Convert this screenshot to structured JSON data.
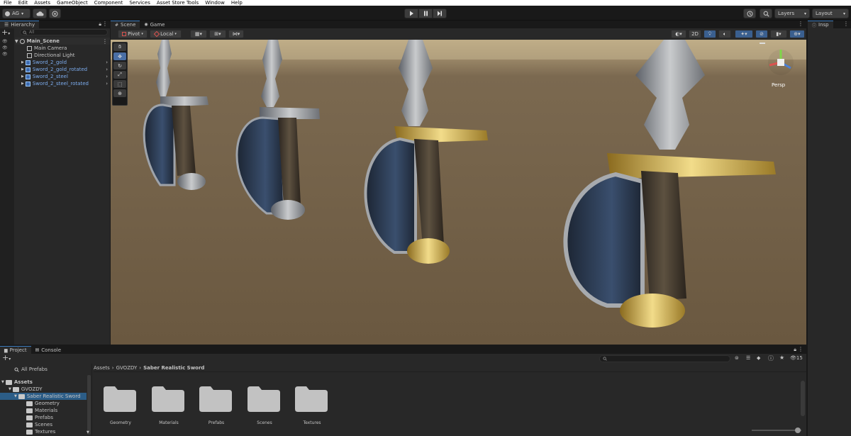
{
  "menu": [
    "File",
    "Edit",
    "Assets",
    "GameObject",
    "Component",
    "Services",
    "Asset Store Tools",
    "Window",
    "Help"
  ],
  "toolbar": {
    "account": "AG",
    "layers": "Layers",
    "layout": "Layout"
  },
  "hierarchy": {
    "tab": "Hierarchy",
    "search_placeholder": "All",
    "scene": "Main_Scene",
    "items": [
      {
        "name": "Main Camera",
        "prefab": false
      },
      {
        "name": "Directional Light",
        "prefab": false
      },
      {
        "name": "Sword_2_gold",
        "prefab": true
      },
      {
        "name": "Sword_2_gold_rotated",
        "prefab": true
      },
      {
        "name": "Sword_2_steel",
        "prefab": true
      },
      {
        "name": "Sword_2_steel_rotated",
        "prefab": true
      }
    ]
  },
  "scene_view": {
    "tabs": [
      "Scene",
      "Game"
    ],
    "pivot": "Pivot",
    "local": "Local",
    "mode_2d": "2D",
    "persp": "Persp",
    "colors": {
      "sky": "#bca881",
      "ground": "#6a5840"
    }
  },
  "inspector": {
    "tab": "Insp"
  },
  "project": {
    "tabs": [
      "Project",
      "Console"
    ],
    "all_prefabs": "All Prefabs",
    "tree": [
      "Assets",
      "GVOZDY",
      "Saber Realistic Sword",
      "Geometry",
      "Materials",
      "Prefabs",
      "Scenes",
      "Textures"
    ],
    "breadcrumb": [
      "Assets",
      "GVOZDY",
      "Saber Realistic Sword"
    ],
    "folders": [
      "Geometry",
      "Materials",
      "Prefabs",
      "Scenes",
      "Textures"
    ],
    "badge_count": "15"
  }
}
